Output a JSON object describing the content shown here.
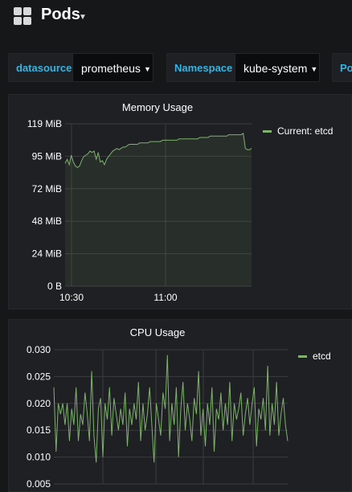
{
  "header": {
    "title": "Pods",
    "app_icon": "apps-grid-icon",
    "caret_icon": "caret-down-icon"
  },
  "variables": [
    {
      "label": "datasource",
      "value": "prometheus"
    },
    {
      "label": "Namespace",
      "value": "kube-system"
    },
    {
      "label": "Po",
      "value": ""
    }
  ],
  "colors": {
    "series": "#7eb26d",
    "label": "#33b5e5",
    "background": "#161719",
    "panel": "#1f2023"
  },
  "panels": {
    "memory": {
      "title": "Memory Usage",
      "legend": "Current: etcd"
    },
    "cpu": {
      "title": "CPU Usage",
      "legend": "etcd"
    }
  },
  "chart_data": [
    {
      "type": "area",
      "title": "Memory Usage",
      "y_unit": "MiB",
      "ylim": [
        0,
        119
      ],
      "y_ticks": [
        "0 B",
        "24 MiB",
        "48 MiB",
        "72 MiB",
        "95 MiB",
        "119 MiB"
      ],
      "x_ticks": [
        "10:30",
        "11:00"
      ],
      "grid": true,
      "legend_placement": "right",
      "series": [
        {
          "name": "Current: etcd",
          "values": [
            90,
            93,
            89,
            96,
            91,
            88,
            87,
            88,
            92,
            95,
            96,
            97,
            99,
            98,
            99,
            93,
            98,
            91,
            92,
            89,
            93,
            95,
            97,
            99,
            100,
            101,
            100,
            101,
            102,
            102,
            103,
            104,
            104,
            104,
            104,
            104,
            105,
            105,
            105,
            105,
            105,
            106,
            106,
            106,
            106,
            106,
            106,
            107,
            107,
            107,
            107,
            107,
            107,
            107,
            107,
            108,
            108,
            108,
            108,
            108,
            108,
            108,
            108,
            108,
            108,
            109,
            109,
            109,
            109,
            109,
            110,
            110,
            110,
            110,
            110,
            110,
            110,
            110,
            110,
            111,
            111,
            111,
            111,
            111,
            111,
            111,
            112,
            101,
            100,
            100,
            101
          ]
        }
      ]
    },
    {
      "type": "line",
      "title": "CPU Usage",
      "ylim": [
        0.005,
        0.03
      ],
      "y_ticks": [
        "0.005",
        "0.010",
        "0.015",
        "0.020",
        "0.025",
        "0.030"
      ],
      "grid": true,
      "legend_placement": "right",
      "series": [
        {
          "name": "etcd",
          "values": [
            0.023,
            0.011,
            0.02,
            0.018,
            0.02,
            0.016,
            0.02,
            0.013,
            0.019,
            0.016,
            0.023,
            0.013,
            0.018,
            0.016,
            0.022,
            0.018,
            0.013,
            0.026,
            0.014,
            0.009,
            0.019,
            0.021,
            0.01,
            0.02,
            0.017,
            0.023,
            0.014,
            0.021,
            0.018,
            0.015,
            0.019,
            0.016,
            0.022,
            0.012,
            0.019,
            0.016,
            0.02,
            0.017,
            0.024,
            0.013,
            0.02,
            0.015,
            0.018,
            0.023,
            0.016,
            0.009,
            0.02,
            0.017,
            0.014,
            0.022,
            0.019,
            0.029,
            0.013,
            0.02,
            0.016,
            0.023,
            0.01,
            0.019,
            0.024,
            0.015,
            0.02,
            0.017,
            0.013,
            0.021,
            0.018,
            0.026,
            0.014,
            0.019,
            0.012,
            0.02,
            0.016,
            0.023,
            0.011,
            0.019,
            0.017,
            0.022,
            0.015,
            0.02,
            0.016,
            0.024,
            0.013,
            0.02,
            0.017,
            0.019,
            0.022,
            0.014,
            0.018,
            0.021,
            0.016,
            0.02,
            0.023,
            0.012,
            0.019,
            0.017,
            0.021,
            0.015,
            0.027,
            0.014,
            0.02,
            0.016,
            0.024,
            0.014,
            0.018,
            0.021,
            0.016,
            0.013
          ]
        }
      ]
    }
  ]
}
